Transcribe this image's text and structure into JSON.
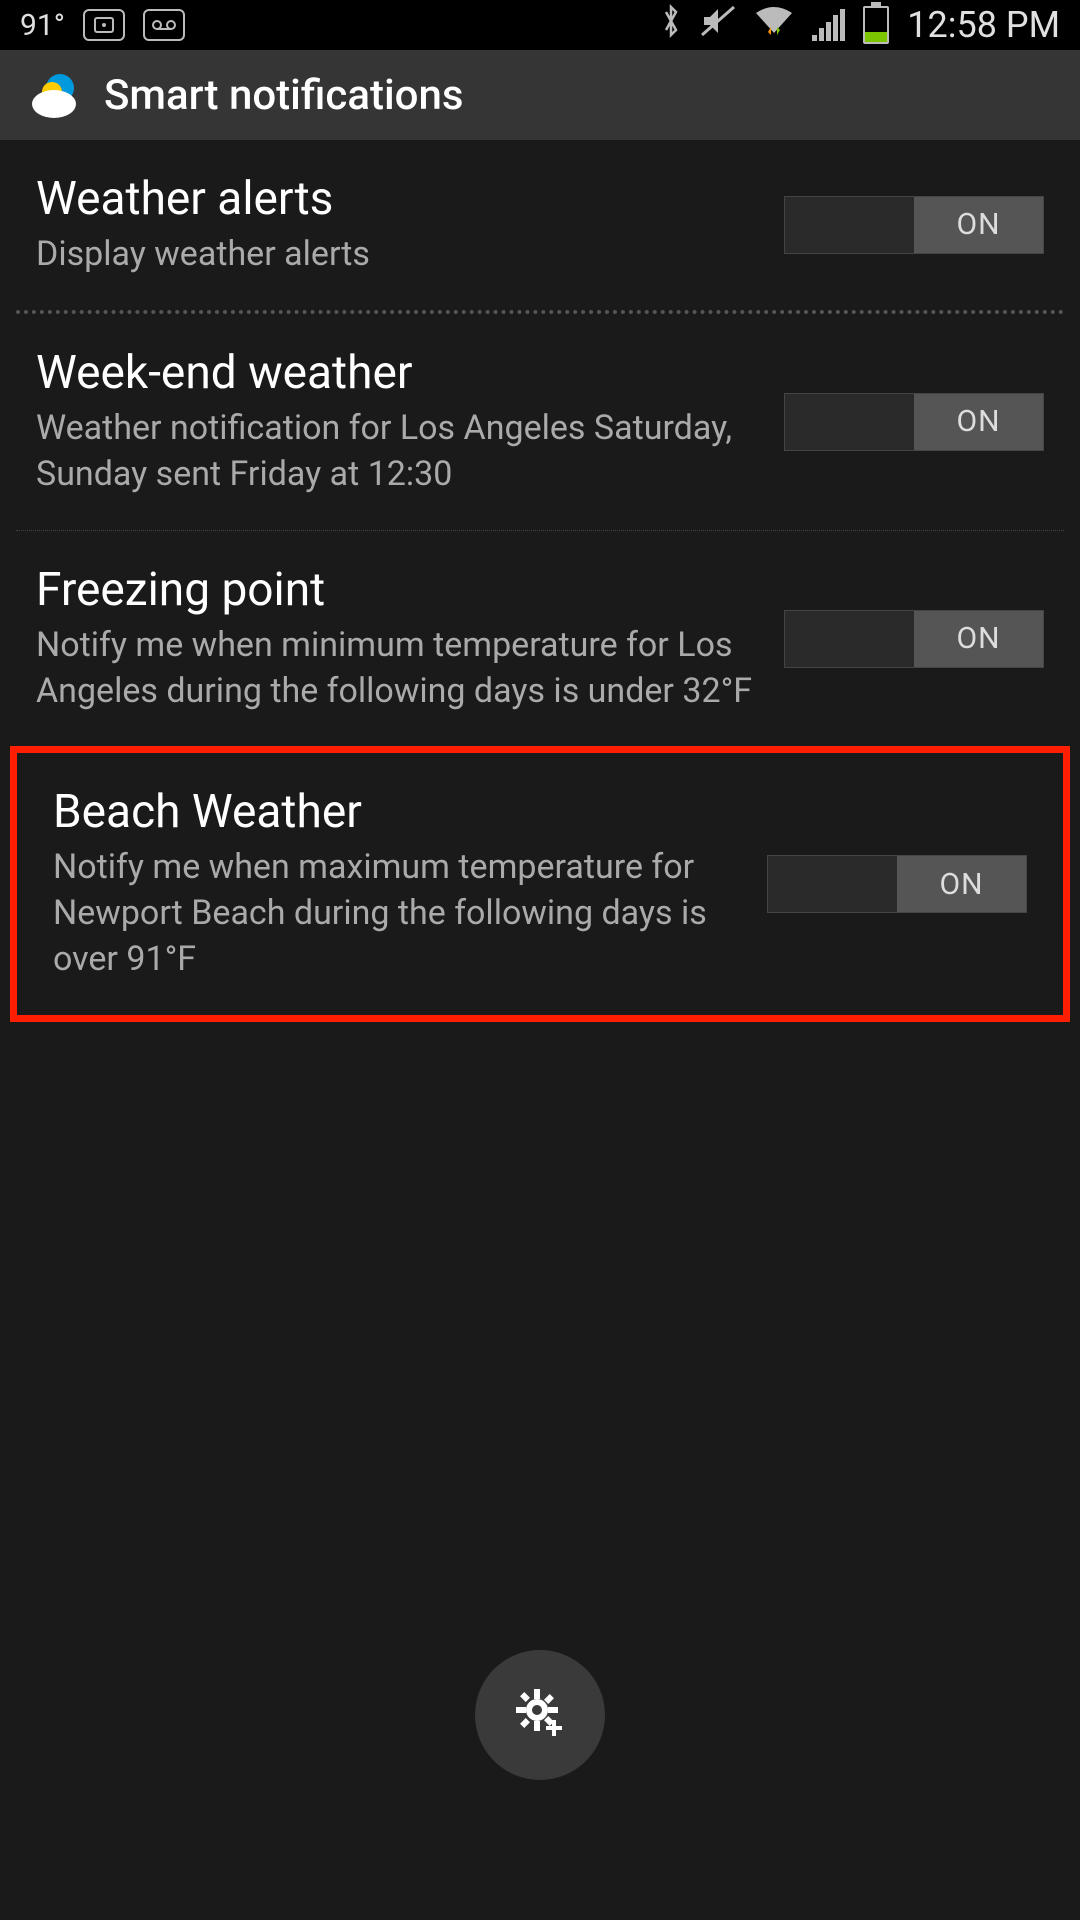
{
  "status": {
    "temp": "91°",
    "time": "12:58 PM"
  },
  "header": {
    "title": "Smart notifications"
  },
  "settings": [
    {
      "title": "Weather alerts",
      "desc": "Display weather alerts",
      "toggle": "ON"
    },
    {
      "title": "Week-end weather",
      "desc": "Weather notification for Los Angeles Saturday, Sunday sent Friday at 12:30",
      "toggle": "ON"
    },
    {
      "title": "Freezing point",
      "desc": "Notify me when minimum temperature for Los Angeles during the following days is under 32°F",
      "toggle": "ON"
    },
    {
      "title": "Beach Weather",
      "desc": "Notify me when maximum temperature for Newport Beach during the following days is over 91°F",
      "toggle": "ON"
    }
  ]
}
